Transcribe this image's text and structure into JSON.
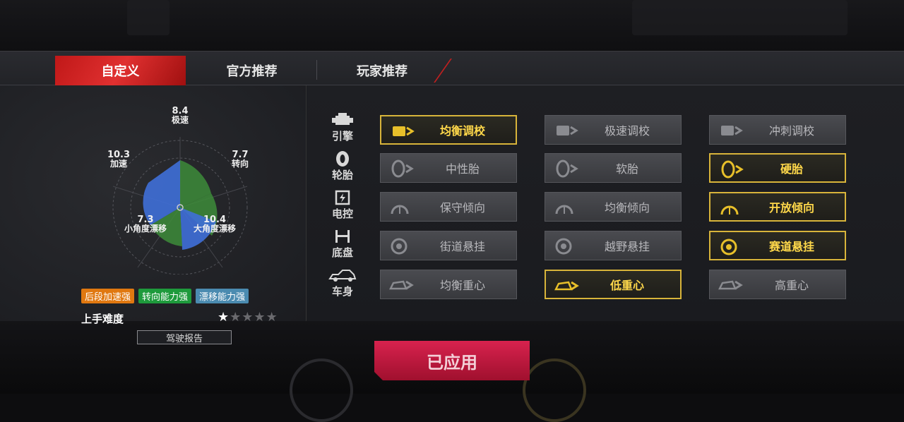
{
  "tabs": [
    {
      "label": "自定义",
      "active": true
    },
    {
      "label": "官方推荐",
      "active": false
    },
    {
      "label": "玩家推荐",
      "active": false
    }
  ],
  "stats": {
    "top_speed": {
      "value": "8.4",
      "label": "极速"
    },
    "steering": {
      "value": "7.7",
      "label": "转向"
    },
    "large_drift": {
      "value": "10.4",
      "label": "大角度漂移"
    },
    "small_drift": {
      "value": "7.3",
      "label": "小角度漂移"
    },
    "acceleration": {
      "value": "10.3",
      "label": "加速"
    }
  },
  "badges": [
    {
      "label": "后段加速强",
      "color": "#e07810"
    },
    {
      "label": "转向能力强",
      "color": "#1e9a3c"
    },
    {
      "label": "漂移能力强",
      "color": "#4b8bb0"
    }
  ],
  "difficulty": {
    "label": "上手难度",
    "rating": 1,
    "max": 5
  },
  "report_button": "驾驶报告",
  "categories": [
    {
      "label": "引擎",
      "icon": "engine-icon",
      "options": [
        {
          "label": "均衡调校",
          "selected": true
        },
        {
          "label": "极速调校",
          "selected": false
        },
        {
          "label": "冲刺调校",
          "selected": false
        }
      ]
    },
    {
      "label": "轮胎",
      "icon": "tire-icon",
      "options": [
        {
          "label": "中性胎",
          "selected": false
        },
        {
          "label": "软胎",
          "selected": false
        },
        {
          "label": "硬胎",
          "selected": true
        }
      ]
    },
    {
      "label": "电控",
      "icon": "chip-icon",
      "options": [
        {
          "label": "保守倾向",
          "selected": false
        },
        {
          "label": "均衡倾向",
          "selected": false
        },
        {
          "label": "开放倾向",
          "selected": true
        }
      ]
    },
    {
      "label": "底盘",
      "icon": "chassis-icon",
      "options": [
        {
          "label": "街道悬挂",
          "selected": false
        },
        {
          "label": "越野悬挂",
          "selected": false
        },
        {
          "label": "赛道悬挂",
          "selected": true
        }
      ]
    },
    {
      "label": "车身",
      "icon": "car-body-icon",
      "options": [
        {
          "label": "均衡重心",
          "selected": false
        },
        {
          "label": "低重心",
          "selected": true
        },
        {
          "label": "高重心",
          "selected": false
        }
      ]
    }
  ],
  "apply_button": "已应用",
  "colors": {
    "accent_red": "#d8224e",
    "selected_gold": "#d8b43a",
    "selected_text": "#ffd84a"
  }
}
